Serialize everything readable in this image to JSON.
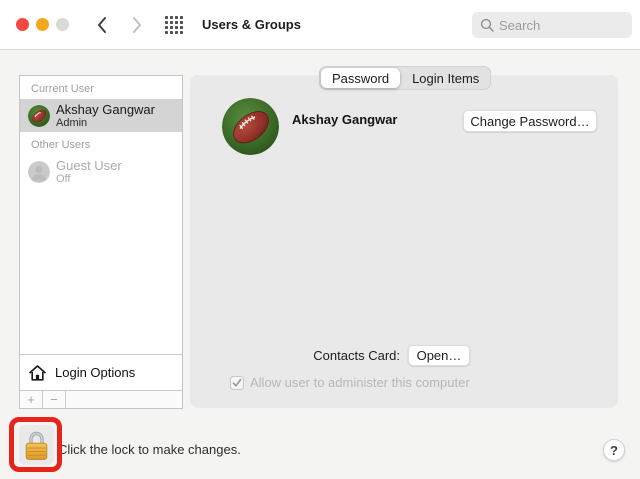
{
  "window": {
    "title": "Users & Groups"
  },
  "toolbar": {
    "search_placeholder": "Search"
  },
  "sidebar": {
    "current_user_header": "Current User",
    "other_users_header": "Other Users",
    "current_user": {
      "name": "Akshay Gangwar",
      "role": "Admin"
    },
    "guest_user": {
      "name": "Guest User",
      "status": "Off"
    },
    "login_options_label": "Login Options",
    "add_button": "+",
    "remove_button": "−"
  },
  "tabs": {
    "password_label": "Password",
    "login_items_label": "Login Items",
    "selected": "Password"
  },
  "main": {
    "user_name": "Akshay Gangwar",
    "change_password_button": "Change Password…",
    "contacts_card_label": "Contacts Card:",
    "open_button": "Open…",
    "admin_checkbox_label": "Allow user to administer this computer",
    "admin_checkbox_checked": true
  },
  "footer": {
    "lock_message": "Click the lock to make changes.",
    "help_button": "?"
  },
  "colors": {
    "annotation_red": "#e8231a",
    "lock_body_orange": "#eda83d",
    "selected_row_gray": "#d4d4d4",
    "panel_gray": "#e9e9e9"
  }
}
